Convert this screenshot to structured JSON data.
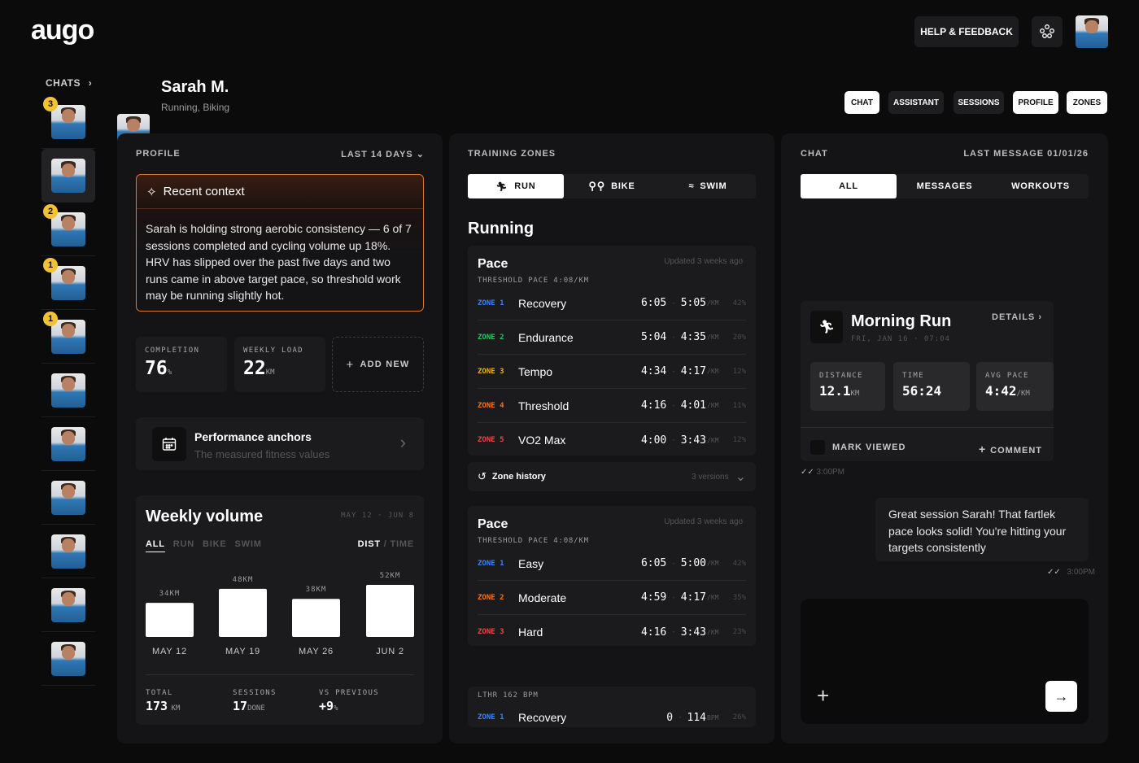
{
  "app": {
    "logo": "augo",
    "help_label": "HELP & FEEDBACK"
  },
  "sidebar": {
    "label": "CHATS",
    "badges": [
      "3",
      "",
      "2",
      "1",
      "1",
      "",
      "",
      "",
      "",
      "",
      ""
    ]
  },
  "user": {
    "name": "Sarah M.",
    "sports": "Running, Biking"
  },
  "nav_pills": [
    "CHAT",
    "ASSISTANT",
    "SESSIONS",
    "PROFILE",
    "ZONES"
  ],
  "profile": {
    "title": "PROFILE",
    "range": "LAST 14 DAYS",
    "context_title": "Recent context",
    "context_text": "Sarah is holding strong aerobic consistency — 6 of 7 sessions completed and cycling volume up 18%. HRV has slipped over the past five days and two runs came in above target pace, so threshold work may be running slightly hot.",
    "completion_label": "COMPLETION",
    "completion_value": "76",
    "completion_unit": "%",
    "load_label": "WEEKLY LOAD",
    "load_value": "22",
    "load_unit": "KM",
    "add_new": "ADD NEW",
    "anchors_title": "Performance anchors",
    "anchors_sub": "The measured fitness values"
  },
  "weekly": {
    "title": "Weekly volume",
    "range": "MAY 12 · JUN 8",
    "filters": [
      "ALL",
      "RUN",
      "BIKE",
      "SWIM"
    ],
    "metric_on": "DIST",
    "metric_sep": " / ",
    "metric_off": "TIME",
    "total_label": "TOTAL",
    "total_value": "173",
    "total_unit": "KM",
    "sessions_label": "SESSIONS",
    "sessions_value": "17",
    "sessions_unit": "DONE",
    "prev_label": "VS PREVIOUS",
    "prev_value": "+9",
    "prev_unit": "%"
  },
  "chart_data": {
    "type": "bar",
    "categories": [
      "MAY 12",
      "MAY 19",
      "MAY 26",
      "JUN 2"
    ],
    "values": [
      34,
      48,
      38,
      52
    ],
    "value_labels": [
      "34KM",
      "48KM",
      "38KM",
      "52KM"
    ],
    "ylim": [
      0,
      52
    ]
  },
  "zones": {
    "title": "TRAINING ZONES",
    "tabs": [
      "RUN",
      "BIKE",
      "SWIM"
    ],
    "section": "Running",
    "block1": {
      "title": "Pace",
      "updated": "Updated 3 weeks ago",
      "threshold": "THRESHOLD PACE 4:08/KM",
      "rows": [
        {
          "zone": "ZONE 1",
          "name": "Recovery",
          "from": "6:05",
          "to": "5:05",
          "unit": "/KM",
          "pct": "42%",
          "color": "#3b82f6"
        },
        {
          "zone": "ZONE 2",
          "name": "Endurance",
          "from": "5:04",
          "to": "4:35",
          "unit": "/KM",
          "pct": "20%",
          "color": "#22c55e"
        },
        {
          "zone": "ZONE 3",
          "name": "Tempo",
          "from": "4:34",
          "to": "4:17",
          "unit": "/KM",
          "pct": "12%",
          "color": "#eab308"
        },
        {
          "zone": "ZONE 4",
          "name": "Threshold",
          "from": "4:16",
          "to": "4:01",
          "unit": "/KM",
          "pct": "11%",
          "color": "#f97316"
        },
        {
          "zone": "ZONE 5",
          "name": "VO2 Max",
          "from": "4:00",
          "to": "3:43",
          "unit": "/KM",
          "pct": "12%",
          "color": "#ef4444"
        }
      ],
      "history": "Zone history",
      "versions": "3 versions"
    },
    "block2": {
      "title": "Pace",
      "updated": "Updated 3 weeks ago",
      "threshold": "THRESHOLD PACE 4:08/KM",
      "rows": [
        {
          "zone": "ZONE 1",
          "name": "Easy",
          "from": "6:05",
          "to": "5:00",
          "unit": "/KM",
          "pct": "42%",
          "color": "#3b82f6"
        },
        {
          "zone": "ZONE 2",
          "name": "Moderate",
          "from": "4:59",
          "to": "4:17",
          "unit": "/KM",
          "pct": "35%",
          "color": "#f97316"
        },
        {
          "zone": "ZONE 3",
          "name": "Hard",
          "from": "4:16",
          "to": "3:43",
          "unit": "/KM",
          "pct": "23%",
          "color": "#ef4444"
        }
      ]
    },
    "block3": {
      "threshold": "LTHR 162 BPM",
      "row": {
        "zone": "ZONE 1",
        "name": "Recovery",
        "from": "0",
        "to": "114",
        "unit": "BPM",
        "pct": "26%",
        "color": "#3b82f6"
      }
    }
  },
  "chat": {
    "title": "CHAT",
    "last": "LAST MESSAGE 01/01/26",
    "tabs": [
      "ALL",
      "MESSAGES",
      "WORKOUTS"
    ],
    "workout": {
      "title": "Morning Run",
      "date": "FRI, JAN 16 · 07:04",
      "details": "DETAILS",
      "distance_label": "DISTANCE",
      "distance_value": "12.1",
      "distance_unit": "KM",
      "time_label": "TIME",
      "time_value": "56:24",
      "pace_label": "AVG PACE",
      "pace_value": "4:42",
      "pace_unit": "/KM",
      "mark_viewed": "MARK VIEWED",
      "comment": "COMMENT"
    },
    "time1": "3:00PM",
    "message": "Great session Sarah! That fartlek pace looks solid! You're hitting your targets consistently",
    "time2": "3:00PM"
  }
}
